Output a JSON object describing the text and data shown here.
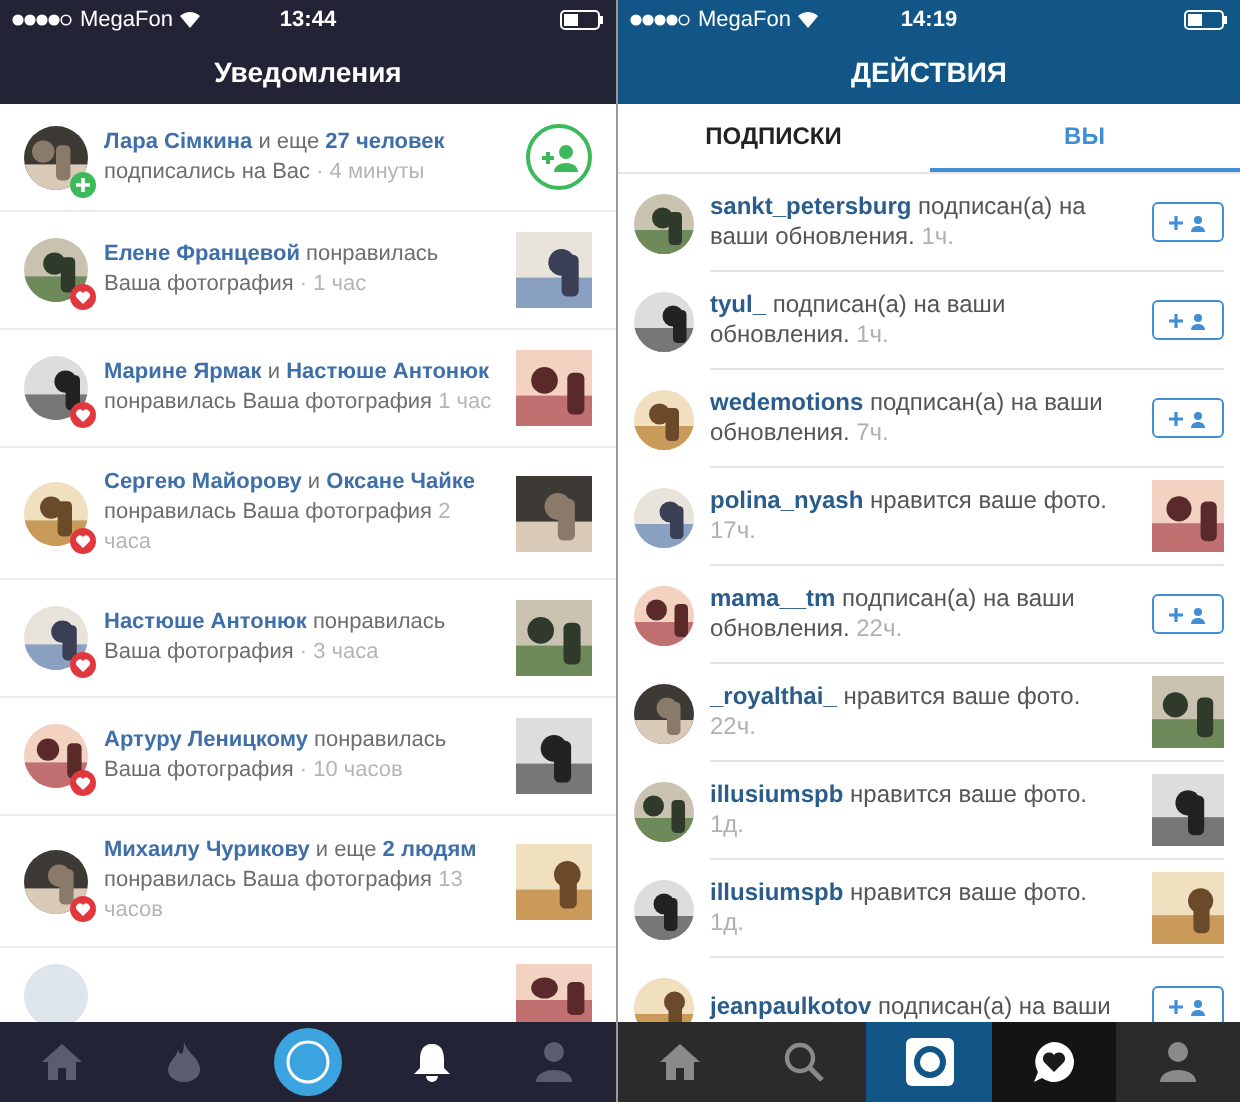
{
  "left": {
    "status_bar": {
      "carrier": "MegaFon",
      "time": "13:44"
    },
    "title": "Уведомления",
    "rows": [
      {
        "kind": "follow",
        "segments": [
          {
            "kind": "name",
            "text": "Лара Сімкина"
          },
          {
            "kind": "plain",
            "text": " и еще "
          },
          {
            "kind": "name",
            "text": "27 человек"
          },
          {
            "kind": "plain",
            "text": " подписались на Вас"
          },
          {
            "kind": "time",
            "text": " · 4 минуты"
          }
        ]
      },
      {
        "kind": "like",
        "segments": [
          {
            "kind": "name",
            "text": "Елене Францевой"
          },
          {
            "kind": "plain",
            "text": " понравилась Ваша фотография"
          },
          {
            "kind": "time",
            "text": " · 1 час"
          }
        ]
      },
      {
        "kind": "like",
        "segments": [
          {
            "kind": "name",
            "text": "Марине Ярмак"
          },
          {
            "kind": "plain",
            "text": " и "
          },
          {
            "kind": "name",
            "text": "Настюше Антонюк"
          },
          {
            "kind": "plain",
            "text": " понравилась Ваша фотография"
          },
          {
            "kind": "time",
            "text": " 1 час"
          }
        ]
      },
      {
        "kind": "like",
        "segments": [
          {
            "kind": "name",
            "text": "Сергею Майорову"
          },
          {
            "kind": "plain",
            "text": " и "
          },
          {
            "kind": "name",
            "text": "Оксане Чайке"
          },
          {
            "kind": "plain",
            "text": " понравилась Ваша фотография"
          },
          {
            "kind": "time",
            "text": " 2 часа"
          }
        ]
      },
      {
        "kind": "like",
        "segments": [
          {
            "kind": "name",
            "text": "Настюше Антонюк"
          },
          {
            "kind": "plain",
            "text": " понравилась Ваша фотография"
          },
          {
            "kind": "time",
            "text": " · 3 часа"
          }
        ]
      },
      {
        "kind": "like",
        "segments": [
          {
            "kind": "name",
            "text": "Артуру Леницкому"
          },
          {
            "kind": "plain",
            "text": " понравилась Ваша фотография"
          },
          {
            "kind": "time",
            "text": " · 10 часов"
          }
        ]
      },
      {
        "kind": "like",
        "segments": [
          {
            "kind": "name",
            "text": "Михаилу Чурикову"
          },
          {
            "kind": "plain",
            "text": " и еще "
          },
          {
            "kind": "name",
            "text": "2 людям"
          },
          {
            "kind": "plain",
            "text": " понравилась Ваша фотография"
          },
          {
            "kind": "time",
            "text": " 13 часов"
          }
        ]
      }
    ],
    "nav": [
      {
        "kind": "home",
        "selected": false
      },
      {
        "kind": "flame",
        "selected": false
      },
      {
        "kind": "camera",
        "selected": false
      },
      {
        "kind": "bell",
        "selected": true
      },
      {
        "kind": "person",
        "selected": false
      }
    ]
  },
  "right": {
    "status_bar": {
      "carrier": "MegaFon",
      "time": "14:19"
    },
    "title": "ДЕЙСТВИЯ",
    "tabs": [
      {
        "label": "ПОДПИСКИ",
        "selected": false
      },
      {
        "label": "ВЫ",
        "selected": true
      }
    ],
    "rows": [
      {
        "kind": "follow",
        "user": "sankt_petersburg",
        "text": " подписан(а) на ваши обновления.",
        "time": " 1ч."
      },
      {
        "kind": "follow",
        "user": "tyul_",
        "text": " подписан(а) на ваши обновления.",
        "time": " 1ч."
      },
      {
        "kind": "follow",
        "user": "wedemotions",
        "text": " подписан(а) на ваши обновления.",
        "time": " 7ч."
      },
      {
        "kind": "like",
        "user": "polina_nyash",
        "text": " нравится ваше фото.",
        "time": " 17ч."
      },
      {
        "kind": "follow",
        "user": "mama__tm",
        "text": " подписан(а) на ваши обновления.",
        "time": " 22ч."
      },
      {
        "kind": "like",
        "user": "_royalthai_",
        "text": " нравится ваше фото.",
        "time": " 22ч."
      },
      {
        "kind": "like",
        "user": "illusiumspb",
        "text": " нравится ваше фото.",
        "time": " 1д."
      },
      {
        "kind": "like",
        "user": "illusiumspb",
        "text": " нравится ваше фото.",
        "time": " 1д."
      },
      {
        "kind": "follow",
        "user": "jeanpaulkotov",
        "text": " подписан(а) на ваши"
      }
    ],
    "nav": [
      {
        "kind": "home",
        "selected": false
      },
      {
        "kind": "search",
        "selected": false
      },
      {
        "kind": "camera",
        "selected": false
      },
      {
        "kind": "activity",
        "selected": true
      },
      {
        "kind": "person",
        "selected": false
      }
    ]
  }
}
